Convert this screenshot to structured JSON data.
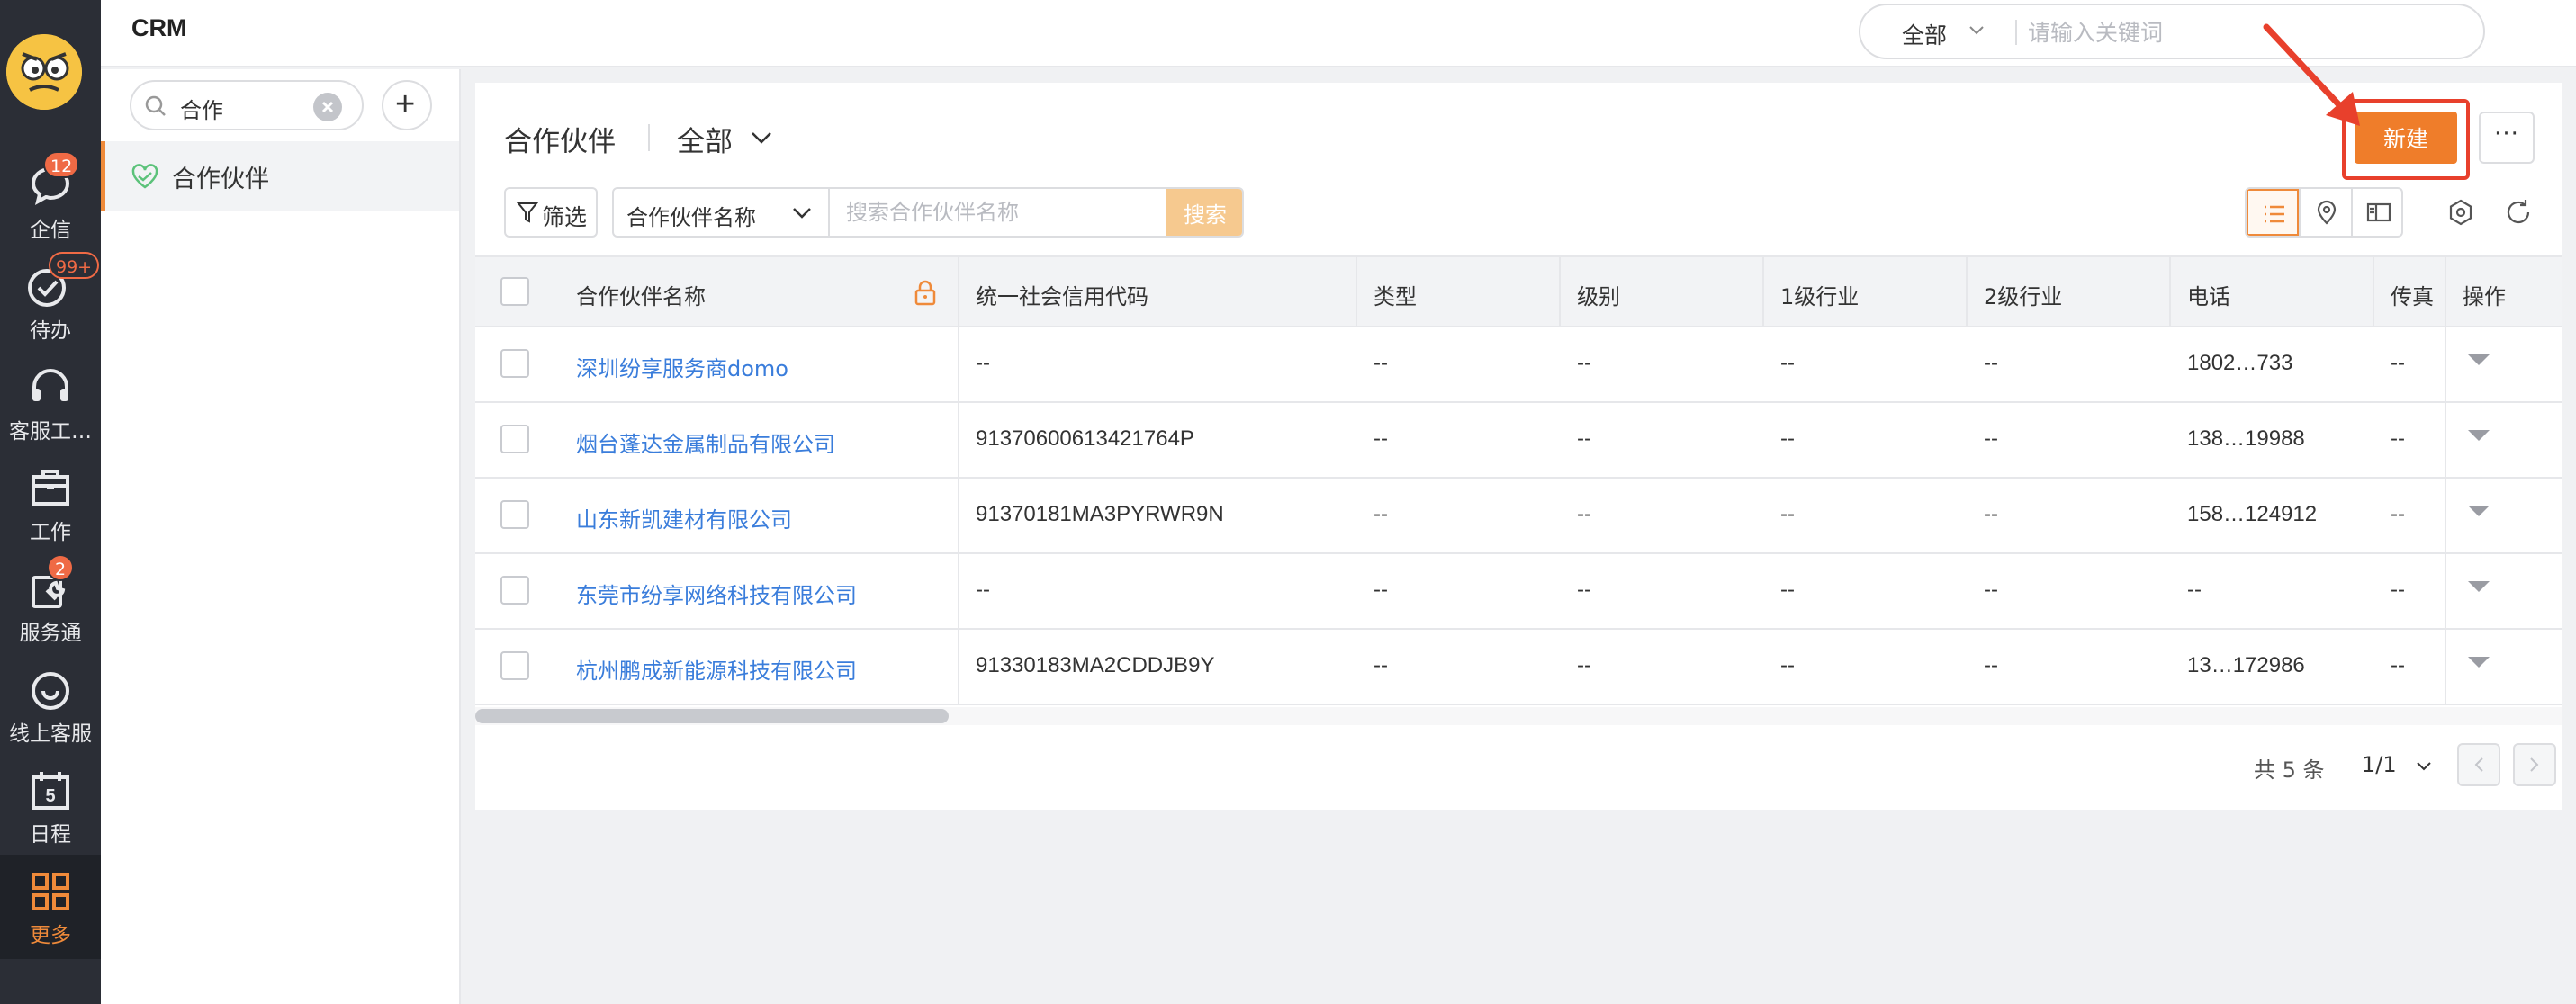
{
  "header": {
    "app_title": "CRM",
    "search_scope": "全部",
    "search_placeholder": "请输入关键词"
  },
  "nav": {
    "items": [
      {
        "label": "企信",
        "icon": "chat-icon",
        "badge": "12"
      },
      {
        "label": "待办",
        "icon": "check-circle-icon",
        "badge": "99+"
      },
      {
        "label": "客服工…",
        "icon": "headset-icon",
        "badge": ""
      },
      {
        "label": "工作",
        "icon": "briefcase-icon",
        "badge": ""
      },
      {
        "label": "服务通",
        "icon": "wrench-icon",
        "badge": "2"
      },
      {
        "label": "线上客服",
        "icon": "smile-icon",
        "badge": ""
      },
      {
        "label": "日程",
        "icon": "calendar-icon",
        "badge": "",
        "icon_text": "5"
      },
      {
        "label": "更多",
        "icon": "grid-icon",
        "badge": ""
      }
    ]
  },
  "sidebar": {
    "search_value": "合作",
    "items": [
      {
        "label": "合作伙伴",
        "icon": "handshake-icon"
      }
    ]
  },
  "main": {
    "title": "合作伙伴",
    "view": "全部",
    "new_button": "新建",
    "more_button": "···",
    "filter_label": "筛选",
    "field_selected": "合作伙伴名称",
    "field_placeholder": "搜索合作伙伴名称",
    "search_button": "搜索",
    "columns": [
      "合作伙伴名称",
      "统一社会信用代码",
      "类型",
      "级别",
      "1级行业",
      "2级行业",
      "电话",
      "传真",
      "操作"
    ],
    "rows": [
      {
        "name": "深圳纷享服务商domo",
        "code": "--",
        "type": "--",
        "level": "--",
        "ind1": "--",
        "ind2": "--",
        "phone": "1802…733",
        "fax": "--"
      },
      {
        "name": "烟台蓬达金属制品有限公司",
        "code": "91370600613421764P",
        "type": "--",
        "level": "--",
        "ind1": "--",
        "ind2": "--",
        "phone": "138…19988",
        "fax": "--"
      },
      {
        "name": "山东新凯建材有限公司",
        "code": "91370181MA3PYRWR9N",
        "type": "--",
        "level": "--",
        "ind1": "--",
        "ind2": "--",
        "phone": "158…124912",
        "fax": "--"
      },
      {
        "name": "东莞市纷享网络科技有限公司",
        "code": "--",
        "type": "--",
        "level": "--",
        "ind1": "--",
        "ind2": "--",
        "phone": "--",
        "fax": "--"
      },
      {
        "name": "杭州鹏成新能源科技有限公司",
        "code": "91330183MA2CDDJB9Y",
        "type": "--",
        "level": "--",
        "ind1": "--",
        "ind2": "--",
        "phone": "13…172986",
        "fax": "--"
      }
    ],
    "pager": {
      "total": "共 5 条",
      "page": "1/1"
    }
  },
  "colors": {
    "accent": "#ef7d2a",
    "nav_bg": "#2b2e36",
    "link": "#3a7ddb",
    "annotation": "#e8402c"
  }
}
